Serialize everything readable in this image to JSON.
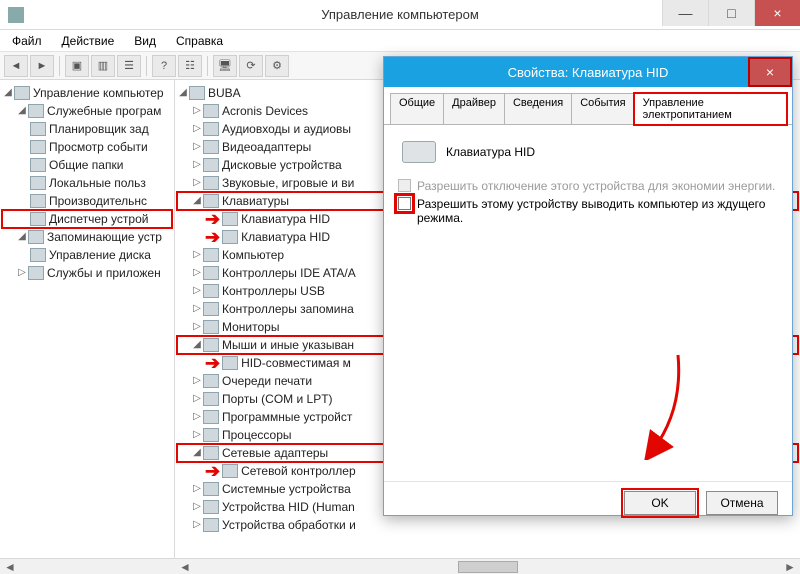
{
  "window": {
    "title": "Управление компьютером",
    "buttons": {
      "min": "—",
      "max": "□",
      "close": "×"
    }
  },
  "menu": {
    "items": [
      "Файл",
      "Действие",
      "Вид",
      "Справка"
    ]
  },
  "toolbar_icons": [
    "back-icon",
    "fwd-icon",
    "up-icon",
    "show-icon",
    "list-icon",
    "sep",
    "help-icon",
    "props-icon",
    "sep",
    "scan-icon",
    "refresh-icon",
    "opts-icon"
  ],
  "left_tree": {
    "root": "Управление компьютер",
    "groups": [
      {
        "label": "Служебные програм",
        "expanded": true,
        "children": [
          "Планировщик зад",
          "Просмотр событи",
          "Общие папки",
          "Локальные польз",
          "Производительнс",
          "Диспетчер устрой"
        ],
        "highlight_child_index": 5
      },
      {
        "label": "Запоминающие устр",
        "expanded": true,
        "children": [
          "Управление диска"
        ]
      },
      {
        "label": "Службы и приложен",
        "expanded": false,
        "children": []
      }
    ]
  },
  "device_tree": {
    "root": "BUBA",
    "items": [
      {
        "label": "Acronis Devices",
        "expanded": false
      },
      {
        "label": "Аудиовходы и аудиовы",
        "expanded": false
      },
      {
        "label": "Видеоадаптеры",
        "expanded": false
      },
      {
        "label": "Дисковые устройства",
        "expanded": false
      },
      {
        "label": "Звуковые, игровые и ви",
        "expanded": false
      },
      {
        "label": "Клавиатуры",
        "expanded": true,
        "highlight": true,
        "children": [
          {
            "label": "Клавиатура HID",
            "arrow": true
          },
          {
            "label": "Клавиатура HID",
            "arrow": true
          }
        ]
      },
      {
        "label": "Компьютер",
        "expanded": false
      },
      {
        "label": "Контроллеры IDE ATA/A",
        "expanded": false
      },
      {
        "label": "Контроллеры USB",
        "expanded": false
      },
      {
        "label": "Контроллеры запомина",
        "expanded": false
      },
      {
        "label": "Мониторы",
        "expanded": false
      },
      {
        "label": "Мыши и иные указыван",
        "expanded": true,
        "highlight": true,
        "children": [
          {
            "label": "HID-совместимая м",
            "arrow": true
          }
        ]
      },
      {
        "label": "Очереди печати",
        "expanded": false
      },
      {
        "label": "Порты (COM и LPT)",
        "expanded": false
      },
      {
        "label": "Программные устройст",
        "expanded": false
      },
      {
        "label": "Процессоры",
        "expanded": false
      },
      {
        "label": "Сетевые адаптеры",
        "expanded": true,
        "highlight": true,
        "children": [
          {
            "label": "Сетевой контроллер",
            "arrow": true
          }
        ]
      },
      {
        "label": "Системные устройства",
        "expanded": false
      },
      {
        "label": "Устройства HID (Human",
        "expanded": false
      },
      {
        "label": "Устройства обработки и",
        "expanded": false
      }
    ]
  },
  "dialog": {
    "title": "Свойства: Клавиатура HID",
    "close": "×",
    "tabs": [
      "Общие",
      "Драйвер",
      "Сведения",
      "События",
      "Управление электропитанием"
    ],
    "active_tab_index": 4,
    "device_name": "Клавиатура HID",
    "check1": "Разрешить отключение этого устройства для экономии энергии.",
    "check2": "Разрешить этому устройству выводить компьютер из ждущего режима.",
    "ok": "OK",
    "cancel": "Отмена"
  }
}
